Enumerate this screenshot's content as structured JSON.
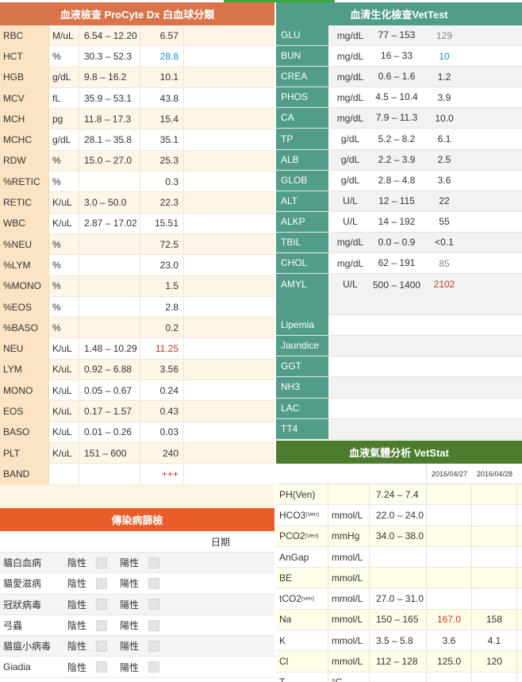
{
  "cbc": {
    "title": "血液檢查 ProCyte Dx 白血球分類",
    "rows": [
      {
        "name": "RBC",
        "unit": "M/uL",
        "range": "6.54 – 12.20",
        "value": "6.57",
        "flag": ""
      },
      {
        "name": "HCT",
        "unit": "%",
        "range": "30.3 – 52.3",
        "value": "28.8",
        "flag": "low"
      },
      {
        "name": "HGB",
        "unit": "g/dL",
        "range": "9.8 – 16.2",
        "value": "10.1",
        "flag": ""
      },
      {
        "name": "MCV",
        "unit": "fL",
        "range": "35.9 – 53.1",
        "value": "43.8",
        "flag": ""
      },
      {
        "name": "MCH",
        "unit": "pg",
        "range": "11.8 – 17.3",
        "value": "15.4",
        "flag": ""
      },
      {
        "name": "MCHC",
        "unit": "g/dL",
        "range": "28.1 – 35.8",
        "value": "35.1",
        "flag": ""
      },
      {
        "name": "RDW",
        "unit": "%",
        "range": "15.0 – 27.0",
        "value": "25.3",
        "flag": ""
      },
      {
        "name": "%RETIC",
        "unit": "%",
        "range": "",
        "value": "0.3",
        "flag": ""
      },
      {
        "name": "RETIC",
        "unit": "K/uL",
        "range": "3.0 – 50.0",
        "value": "22.3",
        "flag": ""
      },
      {
        "name": "WBC",
        "unit": "K/uL",
        "range": "2.87 – 17.02",
        "value": "15.51",
        "flag": ""
      },
      {
        "name": "%NEU",
        "unit": "%",
        "range": "",
        "value": "72.5",
        "flag": ""
      },
      {
        "name": "%LYM",
        "unit": "%",
        "range": "",
        "value": "23.0",
        "flag": ""
      },
      {
        "name": "%MONO",
        "unit": "%",
        "range": "",
        "value": "1.5",
        "flag": ""
      },
      {
        "name": "%EOS",
        "unit": "%",
        "range": "",
        "value": "2.8",
        "flag": ""
      },
      {
        "name": "%BASO",
        "unit": "%",
        "range": "",
        "value": "0.2",
        "flag": ""
      },
      {
        "name": "NEU",
        "unit": "K/uL",
        "range": "1.48 – 10.29",
        "value": "11.25",
        "flag": "high"
      },
      {
        "name": "LYM",
        "unit": "K/uL",
        "range": "0.92 – 6.88",
        "value": "3.56",
        "flag": ""
      },
      {
        "name": "MONO",
        "unit": "K/uL",
        "range": "0.05 – 0.67",
        "value": "0.24",
        "flag": ""
      },
      {
        "name": "EOS",
        "unit": "K/uL",
        "range": "0.17 – 1.57",
        "value": "0.43",
        "flag": ""
      },
      {
        "name": "BASO",
        "unit": "K/uL",
        "range": "0.01 – 0.26",
        "value": "0.03",
        "flag": ""
      },
      {
        "name": "PLT",
        "unit": "K/uL",
        "range": "151 – 600",
        "value": "240",
        "flag": ""
      },
      {
        "name": "BAND",
        "unit": "",
        "range": "",
        "value": "+++",
        "flag": "high"
      }
    ]
  },
  "infectious": {
    "title": "傳染病篩檢",
    "date_label": "日期",
    "negative_label": "陰性",
    "positive_label": "陽性",
    "rows": [
      "貓白血病",
      "貓愛滋病",
      "冠狀病毒",
      "弓蟲",
      "貓瘟小病毒",
      "Giadia"
    ]
  },
  "chemistry": {
    "title": "血清生化檢查VetTest",
    "rows": [
      {
        "name": "GLU",
        "unit": "mg/dL",
        "range": "77 – 153",
        "value": "129",
        "flag": "gray"
      },
      {
        "name": "BUN",
        "unit": "mg/dL",
        "range": "16 – 33",
        "value": "10",
        "flag": "low"
      },
      {
        "name": "CREA",
        "unit": "mg/dL",
        "range": "0.6 – 1.6",
        "value": "1.2",
        "flag": ""
      },
      {
        "name": "PHOS",
        "unit": "mg/dL",
        "range": "4.5 – 10.4",
        "value": "3.9",
        "flag": ""
      },
      {
        "name": "CA",
        "unit": "mg/dL",
        "range": "7.9 – 11.3",
        "value": "10.0",
        "flag": ""
      },
      {
        "name": "TP",
        "unit": "g/dL",
        "range": "5.2 – 8.2",
        "value": "6.1",
        "flag": ""
      },
      {
        "name": "ALB",
        "unit": "g/dL",
        "range": "2.2 – 3.9",
        "value": "2.5",
        "flag": ""
      },
      {
        "name": "GLOB",
        "unit": "g/dL",
        "range": "2.8 – 4.8",
        "value": "3.6",
        "flag": ""
      },
      {
        "name": "ALT",
        "unit": "U/L",
        "range": "12 – 115",
        "value": "22",
        "flag": ""
      },
      {
        "name": "ALKP",
        "unit": "U/L",
        "range": "14 – 192",
        "value": "55",
        "flag": ""
      },
      {
        "name": "TBIL",
        "unit": "mg/dL",
        "range": "0.0 – 0.9",
        "value": "<0.1",
        "flag": ""
      },
      {
        "name": "CHOL",
        "unit": "mg/dL",
        "range": "62 – 191",
        "value": "85",
        "flag": "gray"
      },
      {
        "name": "AMYL",
        "unit": "U/L",
        "range": "500 – 1400",
        "value": "2102",
        "flag": "high",
        "tall": true
      },
      {
        "name": "Lipemia",
        "unit": "",
        "range": "",
        "value": "",
        "flag": ""
      },
      {
        "name": "Jaundice",
        "unit": "",
        "range": "",
        "value": "",
        "flag": ""
      },
      {
        "name": "GGT",
        "unit": "",
        "range": "",
        "value": "",
        "flag": ""
      },
      {
        "name": "NH3",
        "unit": "",
        "range": "",
        "value": "",
        "flag": ""
      },
      {
        "name": "LAC",
        "unit": "",
        "range": "",
        "value": "",
        "flag": ""
      },
      {
        "name": "TT4",
        "unit": "",
        "range": "",
        "value": "",
        "flag": ""
      }
    ]
  },
  "bloodgas": {
    "title": "血液氣體分析 VetStat",
    "dates": [
      "2016/04/27",
      "2016/04/28"
    ],
    "rows": [
      {
        "name": "PH(Ven)",
        "sub": "",
        "unit": "",
        "range": "7.24 – 7.4",
        "v1": "",
        "v2": "",
        "flag": ""
      },
      {
        "name": "HCO3",
        "sub": "(Ven)",
        "unit": "mmol/L",
        "range": "22.0 – 24.0",
        "v1": "",
        "v2": "",
        "flag": ""
      },
      {
        "name": "PCO2",
        "sub": "(Ven)",
        "unit": "mmHg",
        "range": "34.0 – 38.0",
        "v1": "",
        "v2": "",
        "flag": ""
      },
      {
        "name": "AnGap",
        "sub": "",
        "unit": "mmol/L",
        "range": "",
        "v1": "",
        "v2": "",
        "flag": ""
      },
      {
        "name": "BE",
        "sub": "",
        "unit": "mmol/L",
        "range": "",
        "v1": "",
        "v2": "",
        "flag": ""
      },
      {
        "name": "tCO2",
        "sub": "(ven)",
        "unit": "mmol/L",
        "range": "27.0 – 31.0",
        "v1": "",
        "v2": "",
        "flag": ""
      },
      {
        "name": "Na",
        "sub": "",
        "unit": "mmol/L",
        "range": "150 – 165",
        "v1": "167.0",
        "v2": "158",
        "flag": "high"
      },
      {
        "name": "K",
        "sub": "",
        "unit": "mmol/L",
        "range": "3.5 – 5.8",
        "v1": "3.6",
        "v2": "4.1",
        "flag": ""
      },
      {
        "name": "Cl",
        "sub": "",
        "unit": "mmol/L",
        "range": "112 – 128",
        "v1": "125.0",
        "v2": "120",
        "flag": ""
      },
      {
        "name": "T",
        "sub": "",
        "unit": "°C",
        "range": "",
        "v1": "",
        "v2": "",
        "flag": ""
      }
    ]
  },
  "colors": {
    "orange": "#d8744a",
    "teal": "#529c8a",
    "green": "#4c7d2c",
    "red": "#e85d2a"
  }
}
